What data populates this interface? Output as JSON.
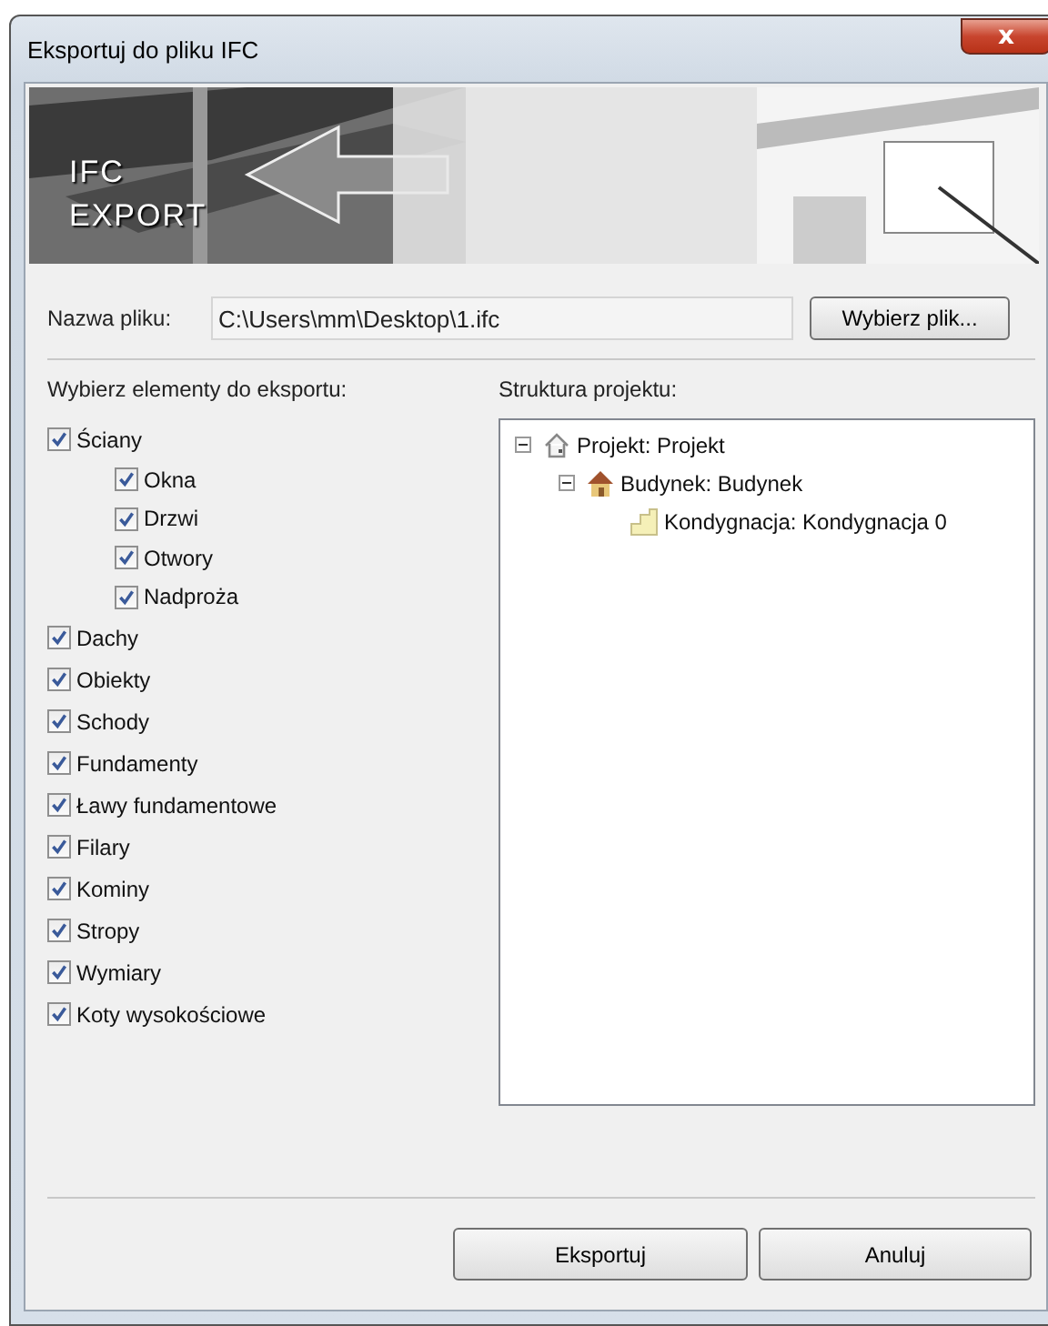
{
  "window": {
    "title": "Eksportuj do pliku IFC",
    "close": "x"
  },
  "banner": {
    "title_lines": [
      "IFC",
      "EXPORT"
    ]
  },
  "file": {
    "label": "Nazwa pliku:",
    "value": "C:\\Users\\mm\\Desktop\\1.ifc",
    "button": "Wybierz plik..."
  },
  "elements": {
    "label": "Wybierz elementy do eksportu:",
    "items": [
      {
        "label": "Ściany",
        "checked": true,
        "children": [
          {
            "label": "Okna",
            "checked": true
          },
          {
            "label": "Drzwi",
            "checked": true
          },
          {
            "label": "Otwory",
            "checked": true
          },
          {
            "label": "Nadproża",
            "checked": true
          }
        ]
      },
      {
        "label": "Dachy",
        "checked": true
      },
      {
        "label": "Obiekty",
        "checked": true
      },
      {
        "label": "Schody",
        "checked": true
      },
      {
        "label": "Fundamenty",
        "checked": true
      },
      {
        "label": "Ławy fundamentowe",
        "checked": true
      },
      {
        "label": "Filary",
        "checked": true
      },
      {
        "label": "Kominy",
        "checked": true
      },
      {
        "label": "Stropy",
        "checked": true
      },
      {
        "label": "Wymiary",
        "checked": true
      },
      {
        "label": "Koty wysokościowe",
        "checked": true
      }
    ]
  },
  "structure": {
    "label": "Struktura projektu:",
    "tree": [
      {
        "label": "Projekt: Projekt",
        "kind": "project",
        "expanded": true,
        "children": [
          {
            "label": "Budynek: Budynek",
            "kind": "building",
            "expanded": true,
            "children": [
              {
                "label": "Kondygnacja: Kondygnacja 0",
                "kind": "storey"
              }
            ]
          }
        ]
      }
    ]
  },
  "buttons": [
    "Eksportuj",
    "Anuluj"
  ]
}
